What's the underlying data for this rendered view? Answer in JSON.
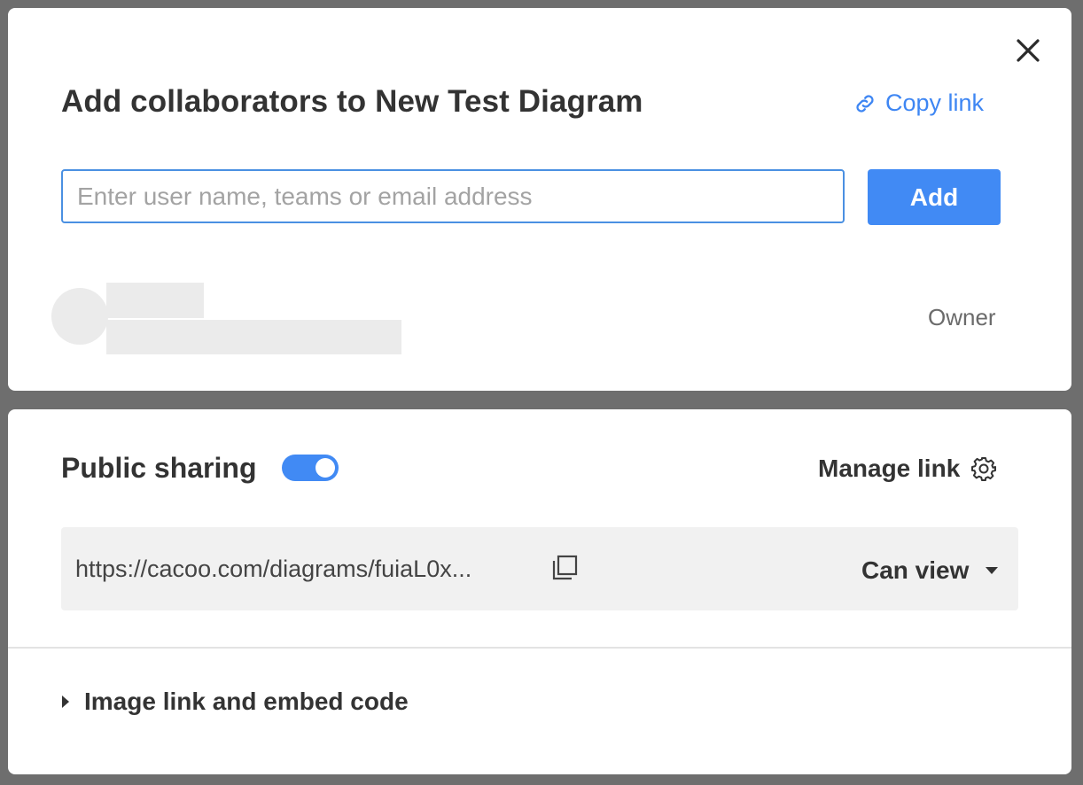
{
  "dialog": {
    "title": "Add collaborators to New Test Diagram",
    "copy_link_label": "Copy link",
    "search_placeholder": "Enter user name, teams or email address",
    "add_button_label": "Add",
    "owner_label": "Owner"
  },
  "sharing": {
    "label": "Public sharing",
    "toggle_on": true,
    "manage_link_label": "Manage link",
    "url": "https://cacoo.com/diagrams/fuiaL0x...",
    "permission": "Can view",
    "embed_label": "Image link and embed code"
  },
  "colors": {
    "accent": "#418af4",
    "link": "#3e86f3",
    "overlay": "#6e6e6e"
  },
  "icons": [
    "close-icon",
    "link-icon",
    "gear-icon",
    "copy-icon",
    "caret-down-icon",
    "caret-right-icon"
  ]
}
